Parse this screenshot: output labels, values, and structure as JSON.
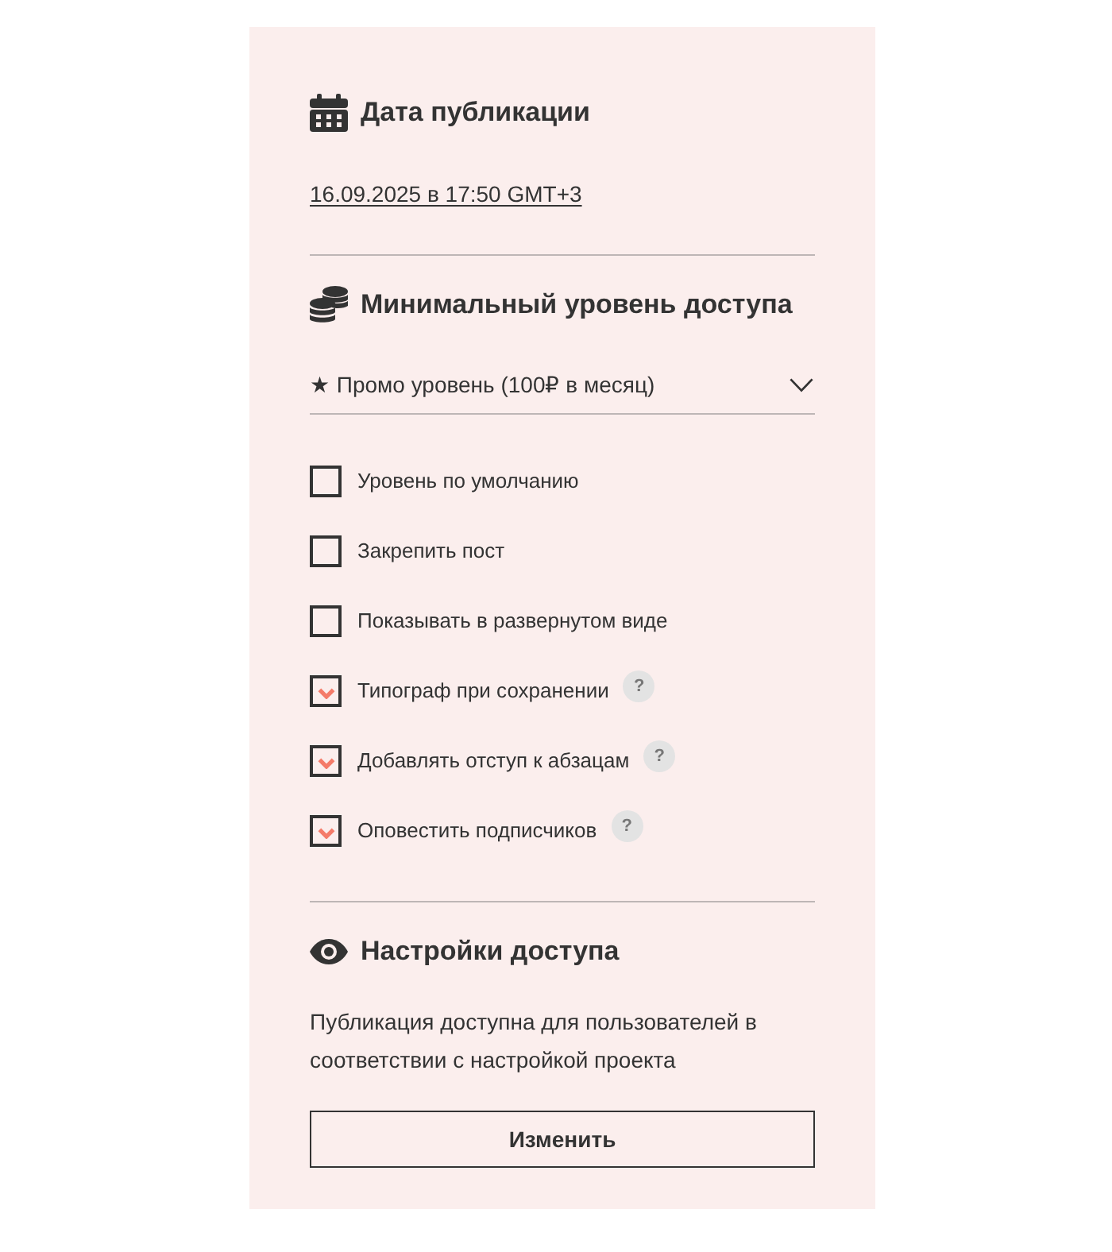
{
  "publication_date": {
    "title": "Дата публикации",
    "date_link": "16.09.2025 в 17:50 GMT+3"
  },
  "access_level": {
    "title": "Минимальный уровень доступа",
    "dropdown": {
      "value": "★ Промо уровень (100₽ в месяц)"
    },
    "options": [
      {
        "label": "Уровень по умолчанию",
        "checked": false
      },
      {
        "label": "Закрепить пост",
        "checked": false
      },
      {
        "label": "Показывать в развернутом виде",
        "checked": false
      },
      {
        "label": "Типограф при сохранении",
        "checked": true,
        "help": "?"
      },
      {
        "label": "Добавлять отступ к абзацам",
        "checked": true,
        "help": "?"
      },
      {
        "label": "Оповестить подписчиков",
        "checked": true,
        "help": "?"
      }
    ]
  },
  "access_settings": {
    "title": "Настройки доступа",
    "description": "Публикация доступна для пользователей в соответствии с настройкой проекта",
    "button": "Изменить"
  }
}
